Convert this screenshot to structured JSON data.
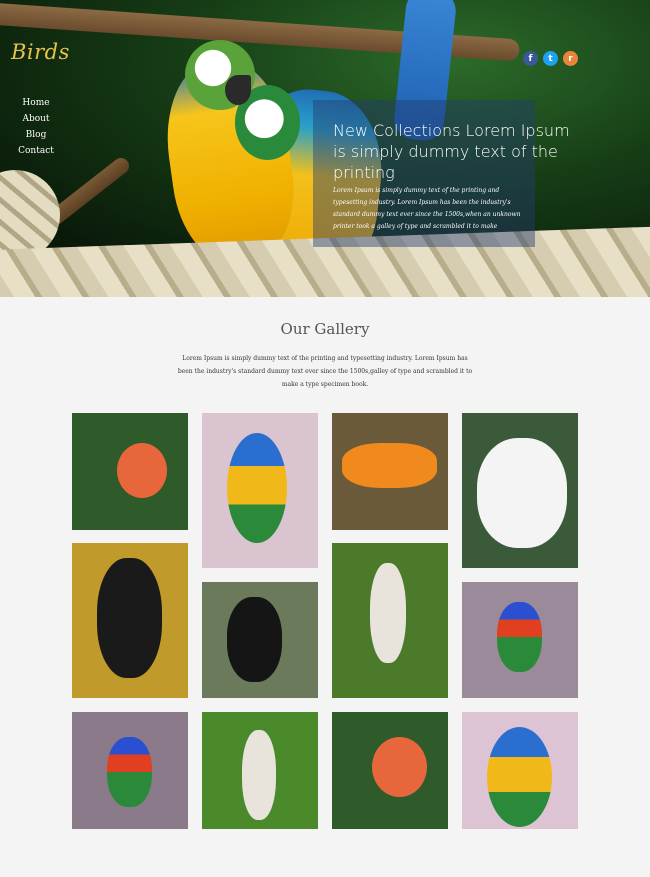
{
  "brand": {
    "logo": "Birds"
  },
  "nav": {
    "items": [
      "Home",
      "About",
      "Blog",
      "Contact"
    ]
  },
  "social": [
    {
      "icon": "facebook-icon",
      "glyph": "f",
      "color": "#3b5998"
    },
    {
      "icon": "twitter-icon",
      "glyph": "t",
      "color": "#1da1f2"
    },
    {
      "icon": "rss-icon",
      "glyph": "r",
      "color": "#e8853a"
    }
  ],
  "hero": {
    "title": "New Collections Lorem Ipsum is simply dummy text of the printing",
    "text": "Lorem Ipsum is simply dummy text of the printing and typesetting industry. Lorem Ipsum has been the industry's standard dummy text ever since the 1500s,when an unknown printer took a galley of type and scrambled it to make"
  },
  "gallery": {
    "title": "Our Gallery",
    "text": "Lorem Ipsum is simply dummy text of the printing and typesetting industry. Lorem Ipsum has been the industry's standard dummy text ever since the 1500s,galley of type and scrambled it to make a type specimen book.",
    "tiles": [
      {
        "name": "scarlet-ibis-photo",
        "bg": "#2f5a2a",
        "bird": "#e8663c"
      },
      {
        "name": "rainbow-lorikeet-photo",
        "bg": "#d9c4d0",
        "bird": "#2a6fd0"
      },
      {
        "name": "lovebirds-photo",
        "bg": "#6a5a3a",
        "bird": "#f08a1c"
      },
      {
        "name": "white-swan-photo",
        "bg": "#3a5a3a",
        "bird": "#f4f4f4"
      },
      {
        "name": "inca-tern-photo",
        "bg": "#c09a2a",
        "bird": "#1a1a1a"
      },
      {
        "name": "toucan-photo",
        "bg": "#6a7a5a",
        "bird": "#151515"
      },
      {
        "name": "white-stork-photo",
        "bg": "#4a7a2a",
        "bird": "#e8e4dc"
      },
      {
        "name": "lorikeet-branch-photo",
        "bg": "#9a8a9a",
        "bird": "#2a8a3a"
      },
      {
        "name": "lorikeet-perched-photo",
        "bg": "#8a7a8a",
        "bird": "#2a8a3a"
      },
      {
        "name": "stork-grass-photo",
        "bg": "#4a8a2a",
        "bird": "#e8e4dc"
      },
      {
        "name": "ibis-foliage-photo",
        "bg": "#2f5a2a",
        "bird": "#e8663c"
      },
      {
        "name": "lorikeet-closeup-photo",
        "bg": "#dcc4d4",
        "bird": "#2a6fd0"
      }
    ]
  }
}
